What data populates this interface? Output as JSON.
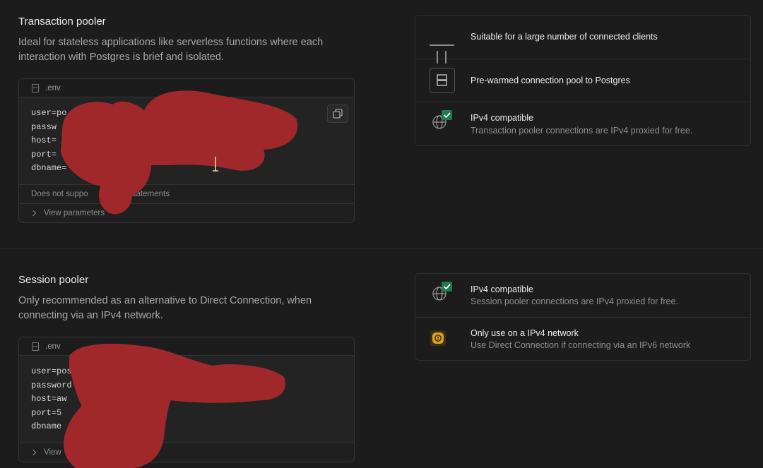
{
  "transaction": {
    "title": "Transaction pooler",
    "description": "Ideal for stateless applications like serverless functions where each interaction with Postgres is brief and isolated.",
    "file_tab": ".env",
    "code_lines": [
      "user=po",
      "passw",
      "host=",
      "port=",
      "dbname="
    ],
    "note": "Does not suppo",
    "note_tail": "RE statements",
    "view_params": "View parameters",
    "features": [
      {
        "title": "Suitable for a large number of connected clients",
        "sub": "",
        "icon": "clients-icon"
      },
      {
        "title": "Pre-warmed connection pool to Postgres",
        "sub": "",
        "icon": "server-icon"
      },
      {
        "title": "IPv4 compatible",
        "sub": "Transaction pooler connections are IPv4 proxied for free.",
        "icon": "globe-check-icon"
      }
    ]
  },
  "session": {
    "title": "Session pooler",
    "description": "Only recommended as an alternative to Direct Connection, when connecting via an IPv4 network.",
    "file_tab": ".env",
    "code_lines": [
      "user=pos",
      "password",
      "host=aw",
      "port=5",
      "dbname"
    ],
    "view_params": "View",
    "features": [
      {
        "title": "IPv4 compatible",
        "sub": "Session pooler connections are IPv4 proxied for free.",
        "icon": "globe-check-icon"
      },
      {
        "title": "Only use on a IPv4 network",
        "sub": "Use Direct Connection if connecting via an IPv6 network",
        "icon": "warning-icon"
      }
    ]
  },
  "colors": {
    "accent_green": "#1f7a4d",
    "warning": "#d9a21b",
    "redaction": "#a1282a"
  }
}
